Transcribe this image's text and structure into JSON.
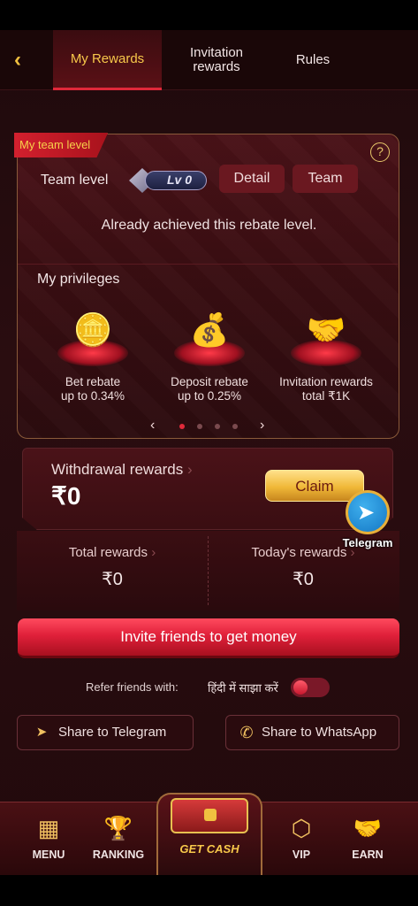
{
  "header": {
    "tabs": [
      {
        "label": "My Rewards",
        "active": true
      },
      {
        "label": "Invitation\nrewards",
        "active": false
      },
      {
        "label": "Rules",
        "active": false
      }
    ]
  },
  "team_card": {
    "ribbon": "My team level",
    "team_label": "Team level",
    "level_badge": "Lv 0",
    "detail_button": "Detail",
    "team_button": "Team",
    "achieved_text": "Already achieved this rebate level.",
    "privileges_title": "My privileges",
    "privileges": [
      {
        "line1": "Bet rebate",
        "line2": "up to 0.34%",
        "icon": "coins-gems-icon"
      },
      {
        "line1": "Deposit rebate",
        "line2": "up to 0.25%",
        "icon": "money-chest-icon"
      },
      {
        "line1": "Invitation rewards",
        "line2": "total ₹1K",
        "icon": "handshake-icon"
      }
    ],
    "pager": {
      "count": 4,
      "active": 0
    }
  },
  "withdrawal": {
    "title": "Withdrawal rewards",
    "amount": "₹0",
    "claim": "Claim"
  },
  "telegram_float": {
    "label": "Telegram"
  },
  "totals": {
    "total_label": "Total rewards",
    "total_value": "₹0",
    "today_label": "Today's rewards",
    "today_value": "₹0"
  },
  "invite_button": "Invite friends to get money",
  "refer": {
    "label": "Refer friends with:",
    "language": "हिंदी में साझा करें",
    "toggle_on": false
  },
  "share": {
    "telegram": "Share to Telegram",
    "whatsapp": "Share to WhatsApp"
  },
  "bottom_nav": {
    "menu": "MENU",
    "ranking": "RANKING",
    "get_cash": "GET CASH",
    "vip": "VIP",
    "earn": "EARN"
  },
  "colors": {
    "accent_red": "#e0203a",
    "gold": "#f7c84a",
    "background": "#2a0d10"
  }
}
